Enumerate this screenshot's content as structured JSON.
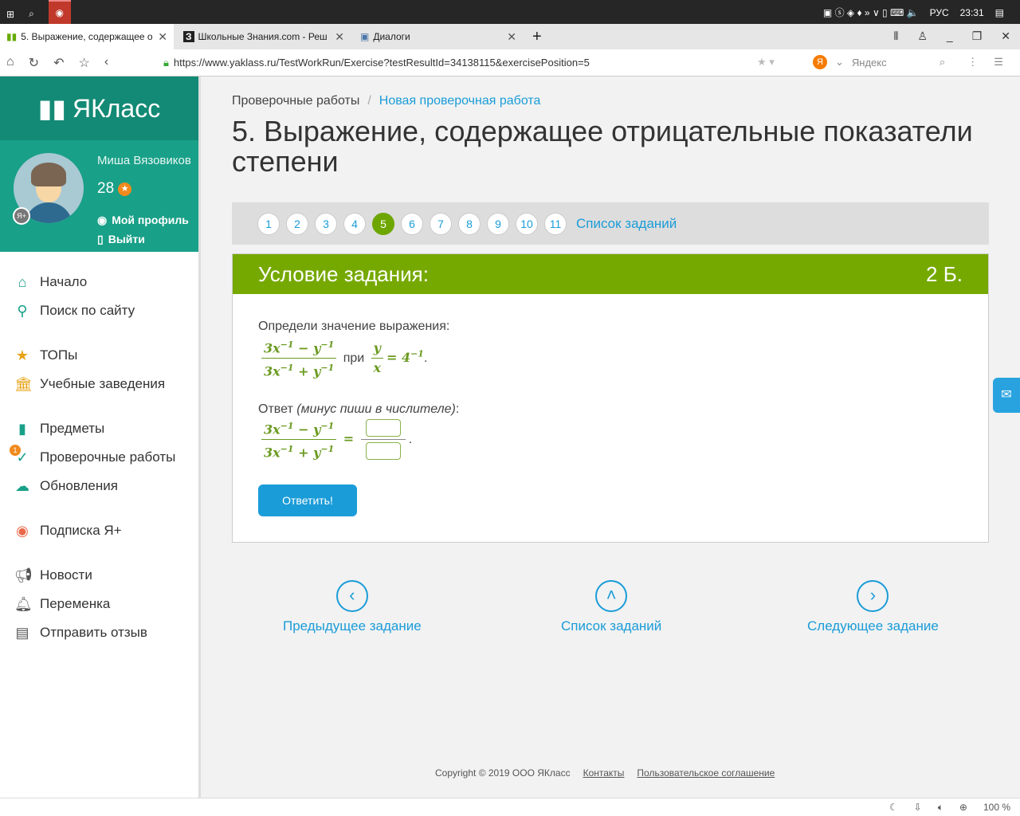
{
  "taskbar": {
    "lang": "РУС",
    "time": "23:31"
  },
  "tabs": [
    {
      "label": "5. Выражение, содержащее о"
    },
    {
      "label": "Школьные Знания.com - Реш"
    },
    {
      "label": "Диалоги"
    }
  ],
  "address": {
    "url": "https://www.yaklass.ru/TestWorkRun/Exercise?testResultId=34138115&exercisePosition=5",
    "search_placeholder": "Яндекс"
  },
  "sidebar": {
    "logo": "ЯКласс",
    "user": "Миша Вязовиков",
    "points": "28",
    "profile": "Мой профиль",
    "logout": "Выйти",
    "items": [
      "Начало",
      "Поиск по сайту",
      "ТОПы",
      "Учебные заведения",
      "Предметы",
      "Проверочные работы",
      "Обновления",
      "Подписка Я+",
      "Новости",
      "Переменка",
      "Отправить отзыв"
    ],
    "badge": "1"
  },
  "breadcrumb": {
    "parent": "Проверочные работы",
    "current": "Новая проверочная работа"
  },
  "title": "5. Выражение, содержащее отрицательные показатели степени",
  "pager": {
    "pages": [
      "1",
      "2",
      "3",
      "4",
      "5",
      "6",
      "7",
      "8",
      "9",
      "10",
      "11"
    ],
    "current": "5",
    "list": "Список заданий"
  },
  "task": {
    "header": "Условие задания:",
    "points": "2 Б.",
    "prompt": "Определи значение выражения:",
    "num": "3x",
    "minus": " − y",
    "den_plus": " + y",
    "exp": "−1",
    "at": "при",
    "y": "y",
    "x": "x",
    "eq": "= 4",
    "answer_label": "Ответ",
    "answer_hint": "(минус пиши в числителе)",
    "button": "Ответить!"
  },
  "nav": {
    "prev": "Предыдущее задание",
    "list": "Список заданий",
    "next": "Следующее задание"
  },
  "footer": {
    "copyright": "Copyright © 2019 ООО ЯКласс",
    "contacts": "Контакты",
    "terms": "Пользовательское соглашение"
  },
  "status": {
    "zoom": "100 %"
  }
}
